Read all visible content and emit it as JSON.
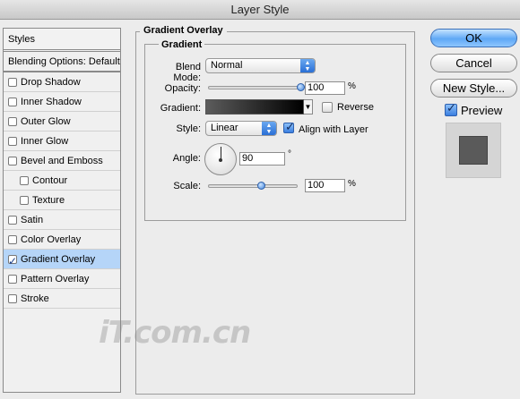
{
  "window": {
    "title": "Layer Style"
  },
  "styles_list": {
    "header": "Styles",
    "blending": "Blending Options: Default",
    "items": [
      {
        "label": "Drop Shadow",
        "checked": false,
        "sub": false,
        "selected": false
      },
      {
        "label": "Inner Shadow",
        "checked": false,
        "sub": false,
        "selected": false
      },
      {
        "label": "Outer Glow",
        "checked": false,
        "sub": false,
        "selected": false
      },
      {
        "label": "Inner Glow",
        "checked": false,
        "sub": false,
        "selected": false
      },
      {
        "label": "Bevel and Emboss",
        "checked": false,
        "sub": false,
        "selected": false
      },
      {
        "label": "Contour",
        "checked": false,
        "sub": true,
        "selected": false
      },
      {
        "label": "Texture",
        "checked": false,
        "sub": true,
        "selected": false
      },
      {
        "label": "Satin",
        "checked": false,
        "sub": false,
        "selected": false
      },
      {
        "label": "Color Overlay",
        "checked": false,
        "sub": false,
        "selected": false
      },
      {
        "label": "Gradient Overlay",
        "checked": true,
        "sub": false,
        "selected": true
      },
      {
        "label": "Pattern Overlay",
        "checked": false,
        "sub": false,
        "selected": false
      },
      {
        "label": "Stroke",
        "checked": false,
        "sub": false,
        "selected": false
      }
    ]
  },
  "panel": {
    "title": "Gradient Overlay",
    "group_title": "Gradient",
    "blend_mode": {
      "label": "Blend Mode:",
      "value": "Normal"
    },
    "opacity": {
      "label": "Opacity:",
      "value": "100",
      "unit": "%",
      "level": 1.0
    },
    "gradient": {
      "label": "Gradient:",
      "reverse_label": "Reverse",
      "reverse_checked": false
    },
    "style": {
      "label": "Style:",
      "value": "Linear",
      "align_label": "Align with Layer",
      "align_checked": true
    },
    "angle": {
      "label": "Angle:",
      "value": "90",
      "unit": "°"
    },
    "scale": {
      "label": "Scale:",
      "value": "100",
      "unit": "%",
      "level": 0.6
    }
  },
  "buttons": {
    "ok": "OK",
    "cancel": "Cancel",
    "new_style": "New Style...",
    "preview_label": "Preview",
    "preview_checked": true
  },
  "watermark": "iT.com.cn",
  "colors": {
    "accent": "#5fa8f5",
    "selected_row": "#b5d5f8"
  }
}
